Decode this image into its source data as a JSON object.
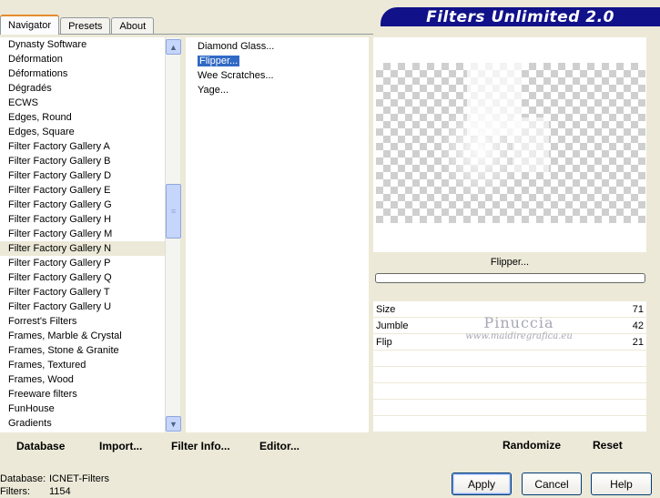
{
  "tabs": [
    {
      "label": "Navigator",
      "active": true
    },
    {
      "label": "Presets",
      "active": false
    },
    {
      "label": "About",
      "active": false
    }
  ],
  "banner": {
    "title": "Filters Unlimited 2.0",
    "color": "#11118a"
  },
  "categories": {
    "items": [
      "Dynasty Software",
      "Déformation",
      "Déformations",
      "Dégradés",
      "ECWS",
      "Edges, Round",
      "Edges, Square",
      "Filter Factory Gallery A",
      "Filter Factory Gallery B",
      "Filter Factory Gallery D",
      "Filter Factory Gallery E",
      "Filter Factory Gallery G",
      "Filter Factory Gallery H",
      "Filter Factory Gallery M",
      "Filter Factory Gallery N",
      "Filter Factory Gallery P",
      "Filter Factory Gallery Q",
      "Filter Factory Gallery T",
      "Filter Factory Gallery U",
      "Forrest's Filters",
      "Frames, Marble & Crystal",
      "Frames, Stone & Granite",
      "Frames, Textured",
      "Frames, Wood",
      "Freeware filters",
      "FunHouse",
      "Gradients"
    ],
    "selected_index": 14
  },
  "filters": {
    "items": [
      "Diamond Glass...",
      "Flipper...",
      "Wee Scratches...",
      "Yage..."
    ],
    "selected_index": 1
  },
  "preview": {
    "filter_name": "Flipper..."
  },
  "progress": {
    "value": 0
  },
  "params": [
    {
      "name": "Size",
      "value": "71"
    },
    {
      "name": "Jumble",
      "value": "42"
    },
    {
      "name": "Flip",
      "value": "21"
    }
  ],
  "watermark": {
    "line1": "Pinuccia",
    "line2": "www.maidiregrafica.eu"
  },
  "lower_toolbar": {
    "database": "Database",
    "import": "Import...",
    "filter_info": "Filter Info...",
    "editor": "Editor...",
    "randomize": "Randomize",
    "reset": "Reset"
  },
  "status": {
    "database_label": "Database:",
    "database_value": "ICNET-Filters",
    "filters_label": "Filters:",
    "filters_value": "1154"
  },
  "buttons": {
    "apply": "Apply",
    "cancel": "Cancel",
    "help": "Help"
  },
  "colors": {
    "selection": "#316ac5",
    "dialog": "#ece9d8",
    "tab_accent": "#e68b2c"
  }
}
